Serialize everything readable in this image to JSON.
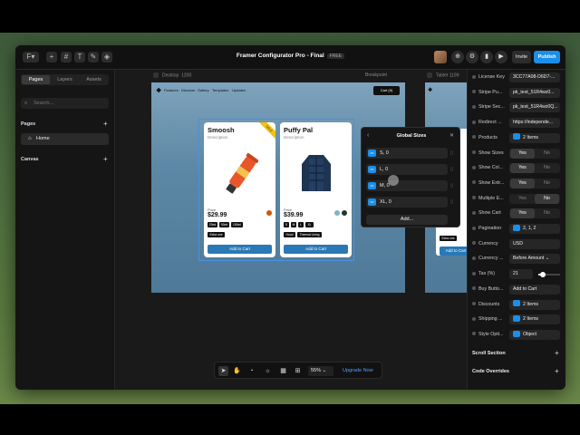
{
  "window": {
    "title": "Framer Configurator Pro - Final",
    "version_badge": "FREE",
    "invite_label": "Invite",
    "publish_label": "Publish"
  },
  "left_panel": {
    "tabs": [
      "Pages",
      "Layers",
      "Assets"
    ],
    "active_tab": "Pages",
    "search_placeholder": "Search...",
    "pages_title": "Pages",
    "pages": [
      {
        "label": "Home",
        "icon": "home-icon"
      }
    ],
    "canvas_title": "Canvas"
  },
  "canvas": {
    "frame_label": "Desktop",
    "frame_width": "1200",
    "breakpoint_label": "Breakpoint",
    "tablet_label": "Tablet",
    "tablet_width": "1199",
    "site_nav": {
      "links": [
        "Features",
        "Discover",
        "Gallery",
        "Templates",
        "Updates"
      ],
      "cart_label": "Cart (0)"
    },
    "products": [
      {
        "title": "Smoosh",
        "description": "Description",
        "badge": "SALE",
        "price_label": "Price",
        "price": "$29.99",
        "sizes": [
          "20ml",
          "50ml",
          "100ml"
        ],
        "extras": [
          "Extra one"
        ],
        "swatch_colors": [
          "#d35400"
        ],
        "button": "Add to Cart"
      },
      {
        "title": "Puffy Pal",
        "description": "Description",
        "price_label": "Price",
        "price": "$39.99",
        "sizes": [
          "S",
          "M",
          "L",
          "XL"
        ],
        "extras": [
          "Hood",
          "Thermal Lining"
        ],
        "swatch_colors": [
          "#7fb3c8",
          "#1e3a2a"
        ],
        "button": "Add to Cart"
      }
    ],
    "tablet_button": "Add to Cart",
    "tablet_chip": "Extra one"
  },
  "popup": {
    "title": "Global Sizes",
    "rows": [
      "S, 0",
      "L, 0",
      "M, 0",
      "XL, 0"
    ],
    "add_label": "Add..."
  },
  "bottom_toolbar": {
    "zoom": "55%",
    "upgrade_label": "Upgrade Now"
  },
  "properties": [
    {
      "label": "License Key",
      "type": "text",
      "value": "3CC77A08-D6D7-..."
    },
    {
      "label": "Stripe Pu...",
      "type": "text",
      "value": "pk_test_51R4wz0..."
    },
    {
      "label": "Stripe Sec...",
      "type": "text",
      "value": "pk_test_51R4wz0Q..."
    },
    {
      "label": "Redirect ...",
      "type": "text",
      "value": "https://independe..."
    },
    {
      "label": "Products",
      "type": "list",
      "value": "2 Items"
    },
    {
      "label": "Show Sizes",
      "type": "toggle",
      "on": "Yes",
      "off": "No",
      "selected": "Yes"
    },
    {
      "label": "Show Col...",
      "type": "toggle",
      "on": "Yes",
      "off": "No",
      "selected": "Yes"
    },
    {
      "label": "Show Extr...",
      "type": "toggle",
      "on": "Yes",
      "off": "No",
      "selected": "Yes"
    },
    {
      "label": "Multiple E...",
      "type": "toggle",
      "on": "Yes",
      "off": "No",
      "selected": "No"
    },
    {
      "label": "Show Cart",
      "type": "toggle",
      "on": "Yes",
      "off": "No",
      "selected": "Yes"
    },
    {
      "label": "Pagination",
      "type": "list",
      "value": "2, 1, 2"
    },
    {
      "label": "Currency",
      "type": "text",
      "value": "USD"
    },
    {
      "label": "Currency ...",
      "type": "select",
      "value": "Before Amount"
    },
    {
      "label": "Tax (%)",
      "type": "slider",
      "value": "21",
      "fraction": 0.21
    },
    {
      "label": "Buy Butto...",
      "type": "text",
      "value": "Add to Cart"
    },
    {
      "label": "Discounts",
      "type": "list",
      "value": "2 Items"
    },
    {
      "label": "Shipping ...",
      "type": "list",
      "value": "2 Items"
    },
    {
      "label": "Style Opti...",
      "type": "list",
      "value": "Object"
    }
  ],
  "right_sections": [
    "Scroll Section",
    "Code Overrides"
  ]
}
